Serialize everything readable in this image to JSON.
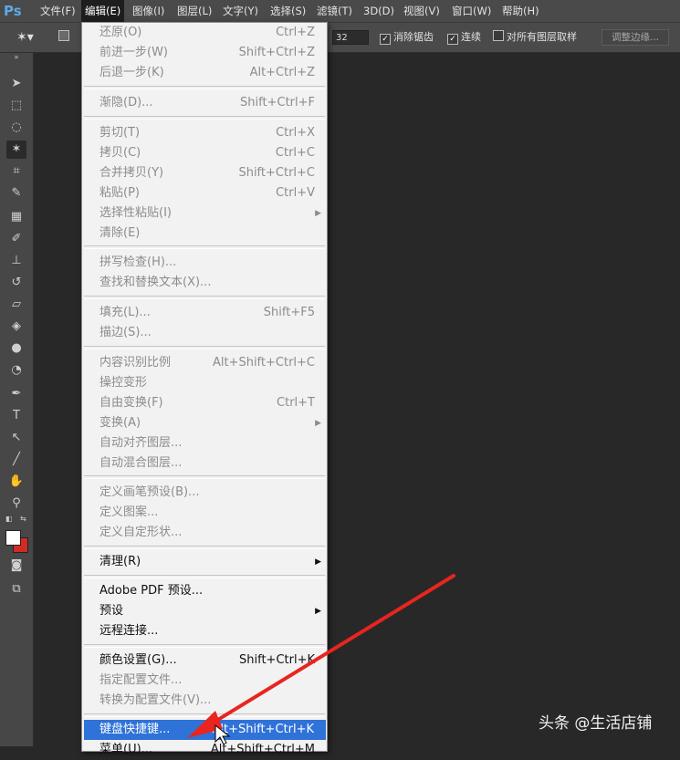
{
  "app": {
    "logo": "Ps"
  },
  "menubar": {
    "items": [
      {
        "label": "文件(F)"
      },
      {
        "label": "编辑(E)"
      },
      {
        "label": "图像(I)"
      },
      {
        "label": "图层(L)"
      },
      {
        "label": "文字(Y)"
      },
      {
        "label": "选择(S)"
      },
      {
        "label": "滤镜(T)"
      },
      {
        "label": "3D(D)"
      },
      {
        "label": "视图(V)"
      },
      {
        "label": "窗口(W)"
      },
      {
        "label": "帮助(H)"
      }
    ]
  },
  "options": {
    "tolerance": "32",
    "antialias_label": "消除锯齿",
    "contiguous_label": "连续",
    "sample_all_label": "对所有图层取样",
    "refine_label": "调整边缘..."
  },
  "edit_menu": {
    "items": [
      {
        "label": "还原(O)",
        "shortcut": "Ctrl+Z"
      },
      {
        "label": "前进一步(W)",
        "shortcut": "Shift+Ctrl+Z"
      },
      {
        "label": "后退一步(K)",
        "shortcut": "Alt+Ctrl+Z"
      },
      {
        "label": "渐隐(D)...",
        "shortcut": "Shift+Ctrl+F"
      },
      {
        "label": "剪切(T)",
        "shortcut": "Ctrl+X"
      },
      {
        "label": "拷贝(C)",
        "shortcut": "Ctrl+C"
      },
      {
        "label": "合并拷贝(Y)",
        "shortcut": "Shift+Ctrl+C"
      },
      {
        "label": "粘贴(P)",
        "shortcut": "Ctrl+V"
      },
      {
        "label": "选择性粘贴(I)",
        "shortcut": ""
      },
      {
        "label": "清除(E)",
        "shortcut": ""
      },
      {
        "label": "拼写检查(H)...",
        "shortcut": ""
      },
      {
        "label": "查找和替换文本(X)...",
        "shortcut": ""
      },
      {
        "label": "填充(L)...",
        "shortcut": "Shift+F5"
      },
      {
        "label": "描边(S)...",
        "shortcut": ""
      },
      {
        "label": "内容识别比例",
        "shortcut": "Alt+Shift+Ctrl+C"
      },
      {
        "label": "操控变形",
        "shortcut": ""
      },
      {
        "label": "自由变换(F)",
        "shortcut": "Ctrl+T"
      },
      {
        "label": "变换(A)",
        "shortcut": ""
      },
      {
        "label": "自动对齐图层...",
        "shortcut": ""
      },
      {
        "label": "自动混合图层...",
        "shortcut": ""
      },
      {
        "label": "定义画笔预设(B)...",
        "shortcut": ""
      },
      {
        "label": "定义图案...",
        "shortcut": ""
      },
      {
        "label": "定义自定形状...",
        "shortcut": ""
      },
      {
        "label": "清理(R)",
        "shortcut": ""
      },
      {
        "label": "Adobe PDF 预设...",
        "shortcut": ""
      },
      {
        "label": "预设",
        "shortcut": ""
      },
      {
        "label": "远程连接...",
        "shortcut": ""
      },
      {
        "label": "颜色设置(G)...",
        "shortcut": "Shift+Ctrl+K"
      },
      {
        "label": "指定配置文件...",
        "shortcut": ""
      },
      {
        "label": "转换为配置文件(V)...",
        "shortcut": ""
      },
      {
        "label": "键盘快捷键...",
        "shortcut": "Alt+Shift+Ctrl+K"
      },
      {
        "label": "菜单(U)...",
        "shortcut": "Alt+Shift+Ctrl+M"
      }
    ]
  },
  "watermark": "头条 @生活店铺",
  "colors": {
    "highlight": "#2f72d8",
    "annotation_arrow": "#e8251f",
    "foreground_swatch": "#ffffff",
    "background_swatch": "#d42a24"
  }
}
